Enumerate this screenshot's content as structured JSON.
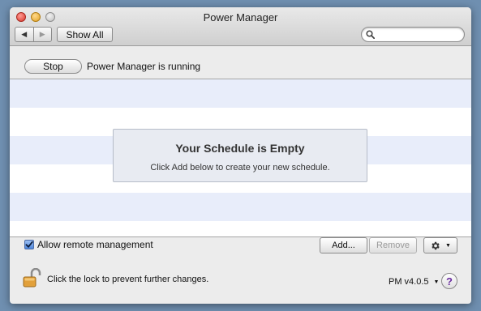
{
  "window": {
    "title": "Power Manager"
  },
  "toolbar": {
    "back_icon": "left-arrow-icon",
    "forward_icon": "right-arrow-icon",
    "show_all_label": "Show All",
    "search": {
      "value": "",
      "placeholder": "",
      "icon": "search-icon"
    }
  },
  "service": {
    "stop_label": "Stop",
    "status_text": "Power Manager is running"
  },
  "schedule": {
    "empty_title": "Your Schedule is Empty",
    "empty_subtitle": "Click Add below to create your new schedule."
  },
  "footer": {
    "remote_checkbox_label": "Allow remote management",
    "remote_checked": true,
    "add_label": "Add...",
    "remove_label": "Remove",
    "gear_icon": "gear-icon",
    "lock_text": "Click the lock to prevent further changes.",
    "version_label": "PM v4.0.5",
    "help_label": "?"
  },
  "colors": {
    "accent": "#4d86dc",
    "help_purple": "#6a2ca0",
    "stripe": "#e8edfa"
  }
}
